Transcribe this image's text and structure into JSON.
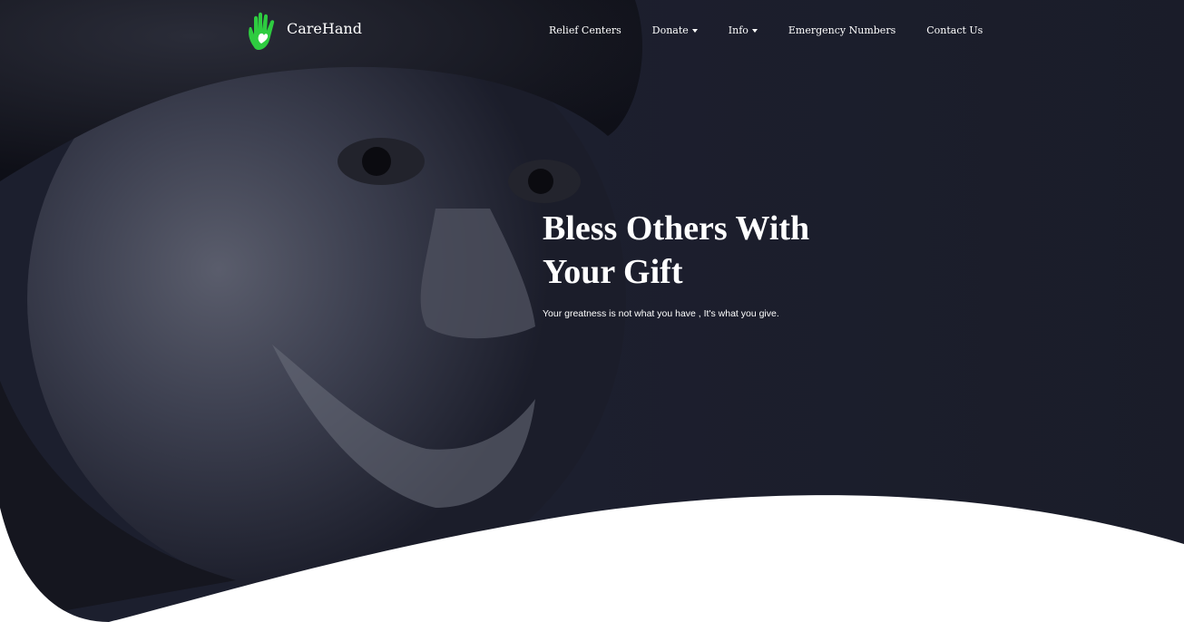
{
  "brand": {
    "name": "CareHand",
    "accent": "#2ecc40"
  },
  "nav": {
    "items": [
      {
        "label": "Relief Centers",
        "dropdown": false
      },
      {
        "label": "Donate",
        "dropdown": true
      },
      {
        "label": "Info",
        "dropdown": true
      },
      {
        "label": "Emergency Numbers",
        "dropdown": false
      },
      {
        "label": "Contact Us",
        "dropdown": false
      }
    ]
  },
  "hero": {
    "title_line1": "Bless Others With",
    "title_line2": "Your Gift",
    "subtitle": "Your greatness is not what you have , It's what you give.",
    "overlay_color": "#1c1f2e",
    "background_color": "#ffffff"
  }
}
